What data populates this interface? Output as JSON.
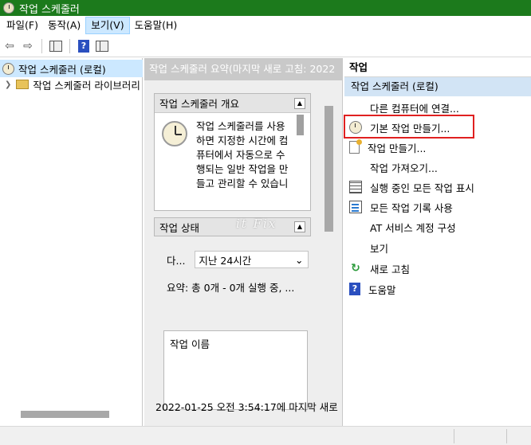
{
  "window": {
    "title": "작업 스케줄러"
  },
  "menu": [
    "파일(F)",
    "동작(A)",
    "보기(V)",
    "도움말(H)"
  ],
  "tree": {
    "root": "작업 스케줄러 (로컬)",
    "library": "작업 스케줄러 라이브러리"
  },
  "middle": {
    "header": "작업 스케줄러 요약(마지막 새로 고침: 2022",
    "overview_title": "작업 스케줄러 개요",
    "overview_text": "작업 스케줄러를 사용하면 지정한 시간에 컴퓨터에서 자동으로 수행되는 일반 작업을 만들고 관리할 수 있습니",
    "status_title": "작업 상태",
    "range_label": "다...",
    "range_value": "지난 24시간",
    "summary": "요약: 총 0개 - 0개 실행 중, ...",
    "task_list_header": "작업 이름",
    "footer": "2022-01-25 오전 3:54:17에 마지막 새로"
  },
  "watermark": "it Fix",
  "actions": {
    "header": "작업",
    "section": "작업 스케줄러 (로컬)",
    "items": [
      {
        "label": "다른 컴퓨터에 연결...",
        "icon": "none"
      },
      {
        "label": "기본 작업 만들기...",
        "icon": "clock-icon"
      },
      {
        "label": "작업 만들기...",
        "icon": "new-task-icon"
      },
      {
        "label": "작업 가져오기...",
        "icon": "none"
      },
      {
        "label": "실행 중인 모든 작업 표시",
        "icon": "running-tasks-icon"
      },
      {
        "label": "모든 작업 기록 사용",
        "icon": "history-icon"
      },
      {
        "label": "AT 서비스 계정 구성",
        "icon": "none"
      },
      {
        "label": "보기",
        "icon": "none"
      },
      {
        "label": "새로 고침",
        "icon": "refresh-icon"
      },
      {
        "label": "도움말",
        "icon": "help-icon"
      }
    ]
  },
  "colors": {
    "titlebar": "#1c7a1c",
    "selection": "#cce8ff",
    "highlight_box": "#e02020"
  }
}
